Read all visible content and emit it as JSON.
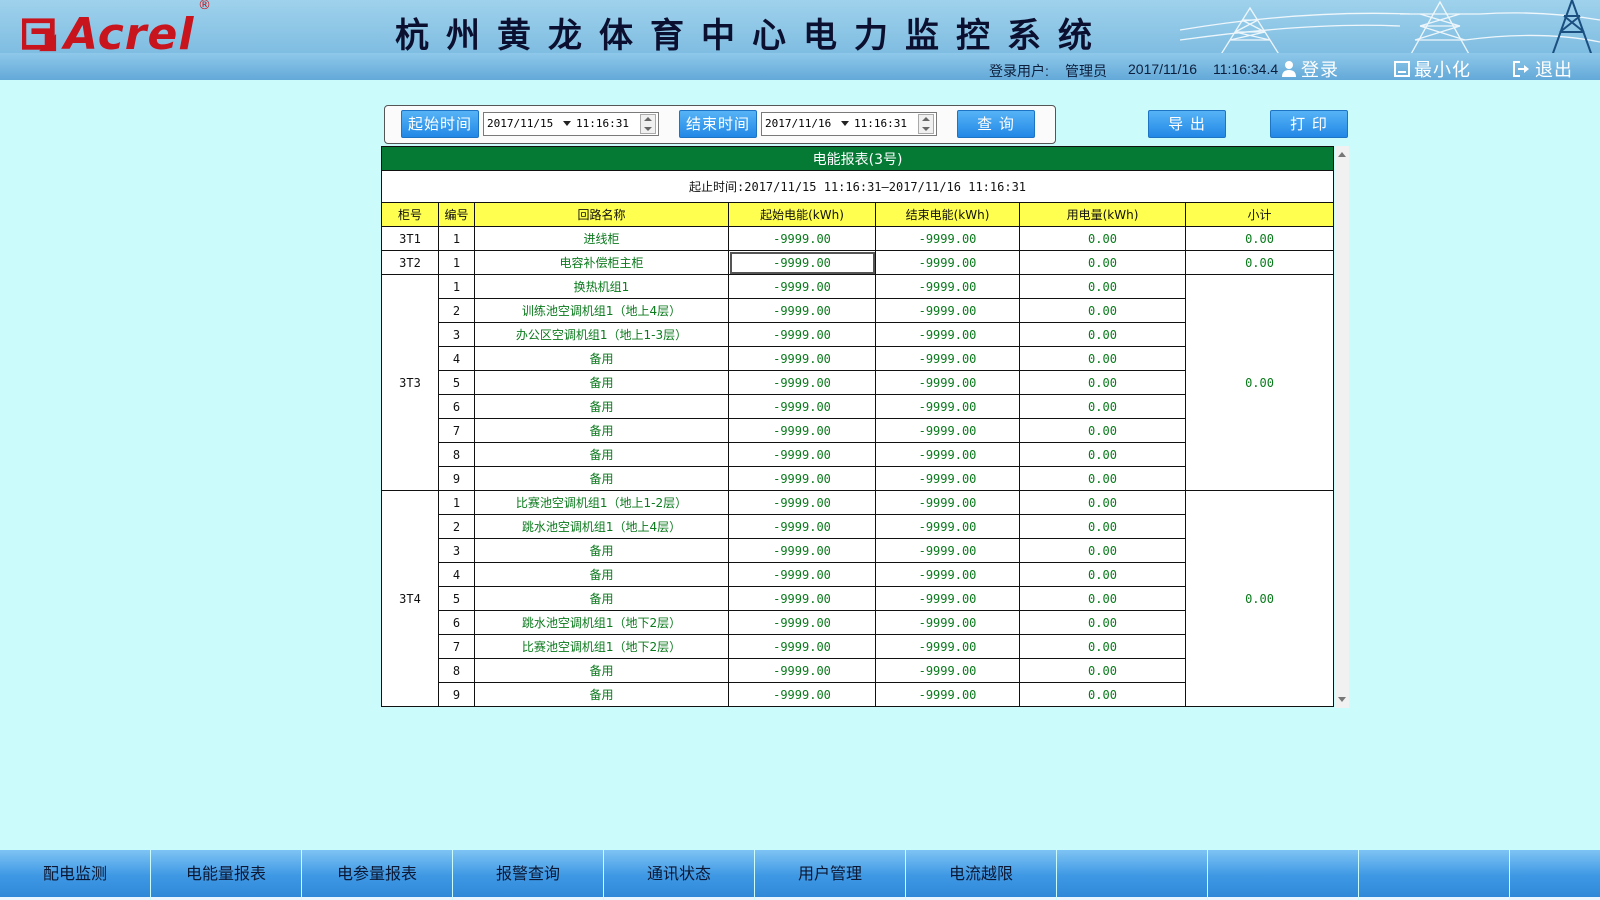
{
  "header": {
    "logo_text": "Acrel",
    "logo_reg": "®",
    "system_title": "杭州黄龙体育中心电力监控系统",
    "login_user_label": "登录用户:",
    "login_user": "管理员",
    "date": "2017/11/16",
    "time": "11:16:34.4",
    "login_btn": "登录",
    "minimize_btn": "最小化",
    "exit_btn": "退出"
  },
  "query": {
    "start_label": "起始时间",
    "start_date": "2017/11/15",
    "start_time": "11:16:31",
    "end_label": "结束时间",
    "end_date": "2017/11/16",
    "end_time": "11:16:31",
    "query_btn": "查 询",
    "export_btn": "导 出",
    "print_btn": "打 印"
  },
  "report": {
    "title": "电能报表(3号)",
    "range": "起止时间:2017/11/15 11:16:31—2017/11/16 11:16:31",
    "columns": [
      "柜号",
      "编号",
      "回路名称",
      "起始电能(kWh)",
      "结束电能(kWh)",
      "用电量(kWh)",
      "小计"
    ],
    "groups": [
      {
        "cabinet": "3T1",
        "subtotal": "0.00",
        "rows": [
          {
            "no": "1",
            "name": "进线柜",
            "start": "-9999.00",
            "end": "-9999.00",
            "usage": "0.00"
          }
        ]
      },
      {
        "cabinet": "3T2",
        "subtotal": "0.00",
        "rows": [
          {
            "no": "1",
            "name": "电容补偿柜主柜",
            "start": "-9999.00",
            "end": "-9999.00",
            "usage": "0.00"
          }
        ]
      },
      {
        "cabinet": "3T3",
        "subtotal": "0.00",
        "rows": [
          {
            "no": "1",
            "name": "换热机组1",
            "start": "-9999.00",
            "end": "-9999.00",
            "usage": "0.00"
          },
          {
            "no": "2",
            "name": "训练池空调机组1（地上4层）",
            "start": "-9999.00",
            "end": "-9999.00",
            "usage": "0.00"
          },
          {
            "no": "3",
            "name": "办公区空调机组1（地上1-3层）",
            "start": "-9999.00",
            "end": "-9999.00",
            "usage": "0.00"
          },
          {
            "no": "4",
            "name": "备用",
            "start": "-9999.00",
            "end": "-9999.00",
            "usage": "0.00"
          },
          {
            "no": "5",
            "name": "备用",
            "start": "-9999.00",
            "end": "-9999.00",
            "usage": "0.00"
          },
          {
            "no": "6",
            "name": "备用",
            "start": "-9999.00",
            "end": "-9999.00",
            "usage": "0.00"
          },
          {
            "no": "7",
            "name": "备用",
            "start": "-9999.00",
            "end": "-9999.00",
            "usage": "0.00"
          },
          {
            "no": "8",
            "name": "备用",
            "start": "-9999.00",
            "end": "-9999.00",
            "usage": "0.00"
          },
          {
            "no": "9",
            "name": "备用",
            "start": "-9999.00",
            "end": "-9999.00",
            "usage": "0.00"
          }
        ]
      },
      {
        "cabinet": "3T4",
        "subtotal": "0.00",
        "rows": [
          {
            "no": "1",
            "name": "比赛池空调机组1（地上1-2层）",
            "start": "-9999.00",
            "end": "-9999.00",
            "usage": "0.00"
          },
          {
            "no": "2",
            "name": "跳水池空调机组1（地上4层）",
            "start": "-9999.00",
            "end": "-9999.00",
            "usage": "0.00"
          },
          {
            "no": "3",
            "name": "备用",
            "start": "-9999.00",
            "end": "-9999.00",
            "usage": "0.00"
          },
          {
            "no": "4",
            "name": "备用",
            "start": "-9999.00",
            "end": "-9999.00",
            "usage": "0.00"
          },
          {
            "no": "5",
            "name": "备用",
            "start": "-9999.00",
            "end": "-9999.00",
            "usage": "0.00"
          },
          {
            "no": "6",
            "name": "跳水池空调机组1（地下2层）",
            "start": "-9999.00",
            "end": "-9999.00",
            "usage": "0.00"
          },
          {
            "no": "7",
            "name": "比赛池空调机组1（地下2层）",
            "start": "-9999.00",
            "end": "-9999.00",
            "usage": "0.00"
          },
          {
            "no": "8",
            "name": "备用",
            "start": "-9999.00",
            "end": "-9999.00",
            "usage": "0.00"
          },
          {
            "no": "9",
            "name": "备用",
            "start": "-9999.00",
            "end": "-9999.00",
            "usage": "0.00"
          }
        ]
      }
    ]
  },
  "nav": {
    "items": [
      "配电监测",
      "电能量报表",
      "电参量报表",
      "报警查询",
      "通讯状态",
      "用户管理",
      "电流越限",
      "",
      "",
      ""
    ]
  },
  "colors": {
    "background": "#ccfbfb",
    "header_blue": "#6fb2dc",
    "table_title_green": "#047a34",
    "table_header_yellow": "#ffff4f",
    "value_green": "#0a7a1c",
    "button_blue": "#2288e6"
  }
}
